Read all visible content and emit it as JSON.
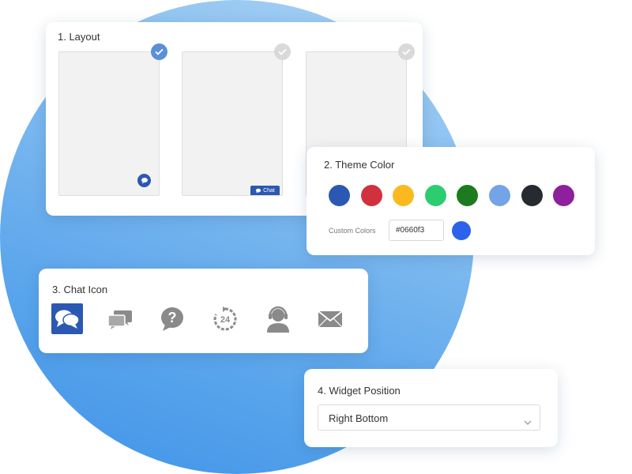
{
  "layout": {
    "title": "1. Layout",
    "options": [
      {
        "style": "bubble",
        "selected": true
      },
      {
        "style": "tab",
        "label": "Chat",
        "selected": false
      },
      {
        "style": "none",
        "selected": false
      }
    ]
  },
  "theme": {
    "title": "2. Theme Color",
    "swatches": [
      "#2b58b2",
      "#d1313d",
      "#fbb91f",
      "#2ecc71",
      "#1e7a1e",
      "#75a3e8",
      "#262b31",
      "#8e1f9d"
    ],
    "custom_label": "Custom Colors",
    "custom_value": "#0660f3",
    "custom_preview": "#2c62ec"
  },
  "chat_icon": {
    "title": "3. Chat Icon",
    "icons": [
      "speech-bubbles-icon",
      "chat-bubbles-icon",
      "question-icon",
      "support-24-icon",
      "headset-agent-icon",
      "envelope-icon"
    ],
    "selected_index": 0
  },
  "position": {
    "title": "4. Widget Position",
    "selected": "Right Bottom"
  },
  "colors": {
    "accent": "#2b58b2",
    "check_selected": "#5b8fd8",
    "icon_gray": "#8a8a8a"
  }
}
